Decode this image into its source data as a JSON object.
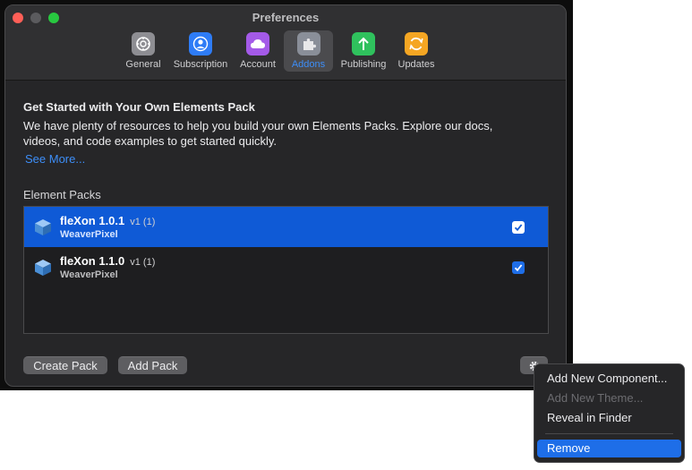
{
  "window": {
    "title": "Preferences"
  },
  "tabs": [
    {
      "label": "General",
      "icon": "gear-icon",
      "color": "#8e8e93"
    },
    {
      "label": "Subscription",
      "icon": "person-icon",
      "color": "#2e7cf6"
    },
    {
      "label": "Account",
      "icon": "cloud-icon",
      "color": "#a45ae8"
    },
    {
      "label": "Addons",
      "icon": "puzzle-icon",
      "color": "#8a8f99"
    },
    {
      "label": "Publishing",
      "icon": "upload-arrow-icon",
      "color": "#2fc15d"
    },
    {
      "label": "Updates",
      "icon": "refresh-icon",
      "color": "#f5a623"
    }
  ],
  "selected_tab": "Addons",
  "intro": {
    "heading": "Get Started with Your Own Elements Pack",
    "body": "We have plenty of resources to help you build your own Elements Packs. Explore our docs, videos, and code examples to get started quickly.",
    "link": "See More..."
  },
  "packs": {
    "section_label": "Element Packs",
    "items": [
      {
        "name": "fleXon 1.0.1",
        "version": "v1 (1)",
        "vendor": "WeaverPixel",
        "enabled": true,
        "selected": true
      },
      {
        "name": "fleXon 1.1.0",
        "version": "v1 (1)",
        "vendor": "WeaverPixel",
        "enabled": true,
        "selected": false
      }
    ]
  },
  "buttons": {
    "create": "Create Pack",
    "add": "Add Pack"
  },
  "context_menu": {
    "items": [
      {
        "label": "Add New Component...",
        "enabled": true
      },
      {
        "label": "Add New Theme...",
        "enabled": false
      },
      {
        "label": "Reveal in Finder",
        "enabled": true
      },
      {
        "label": "Remove",
        "enabled": true,
        "highlighted": true
      }
    ]
  },
  "colors": {
    "accent": "#3d8ef8",
    "selection": "#0f5ad6"
  }
}
